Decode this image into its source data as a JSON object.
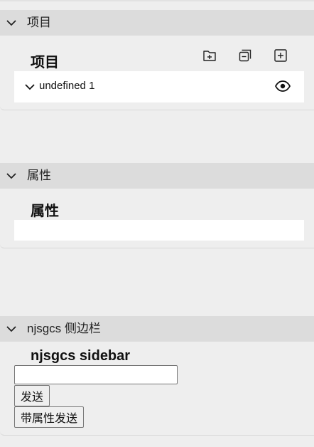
{
  "projects": {
    "header_label": "项目",
    "title": "项目",
    "toolbar": {
      "new_folder_icon": "folder-plus-icon",
      "collapse_all_icon": "collapse-all-icon",
      "add_icon": "square-plus-icon"
    },
    "items": [
      {
        "label": "undefined 1",
        "expanded": true,
        "visibility_icon": "eye-icon"
      }
    ]
  },
  "properties": {
    "header_label": "属性",
    "title": "属性"
  },
  "sidebar": {
    "header_label": "njsgcs 侧边栏",
    "title": "njsgcs sidebar",
    "input_value": "",
    "send_label": "发送",
    "send_with_props_label": "带属性发送"
  }
}
